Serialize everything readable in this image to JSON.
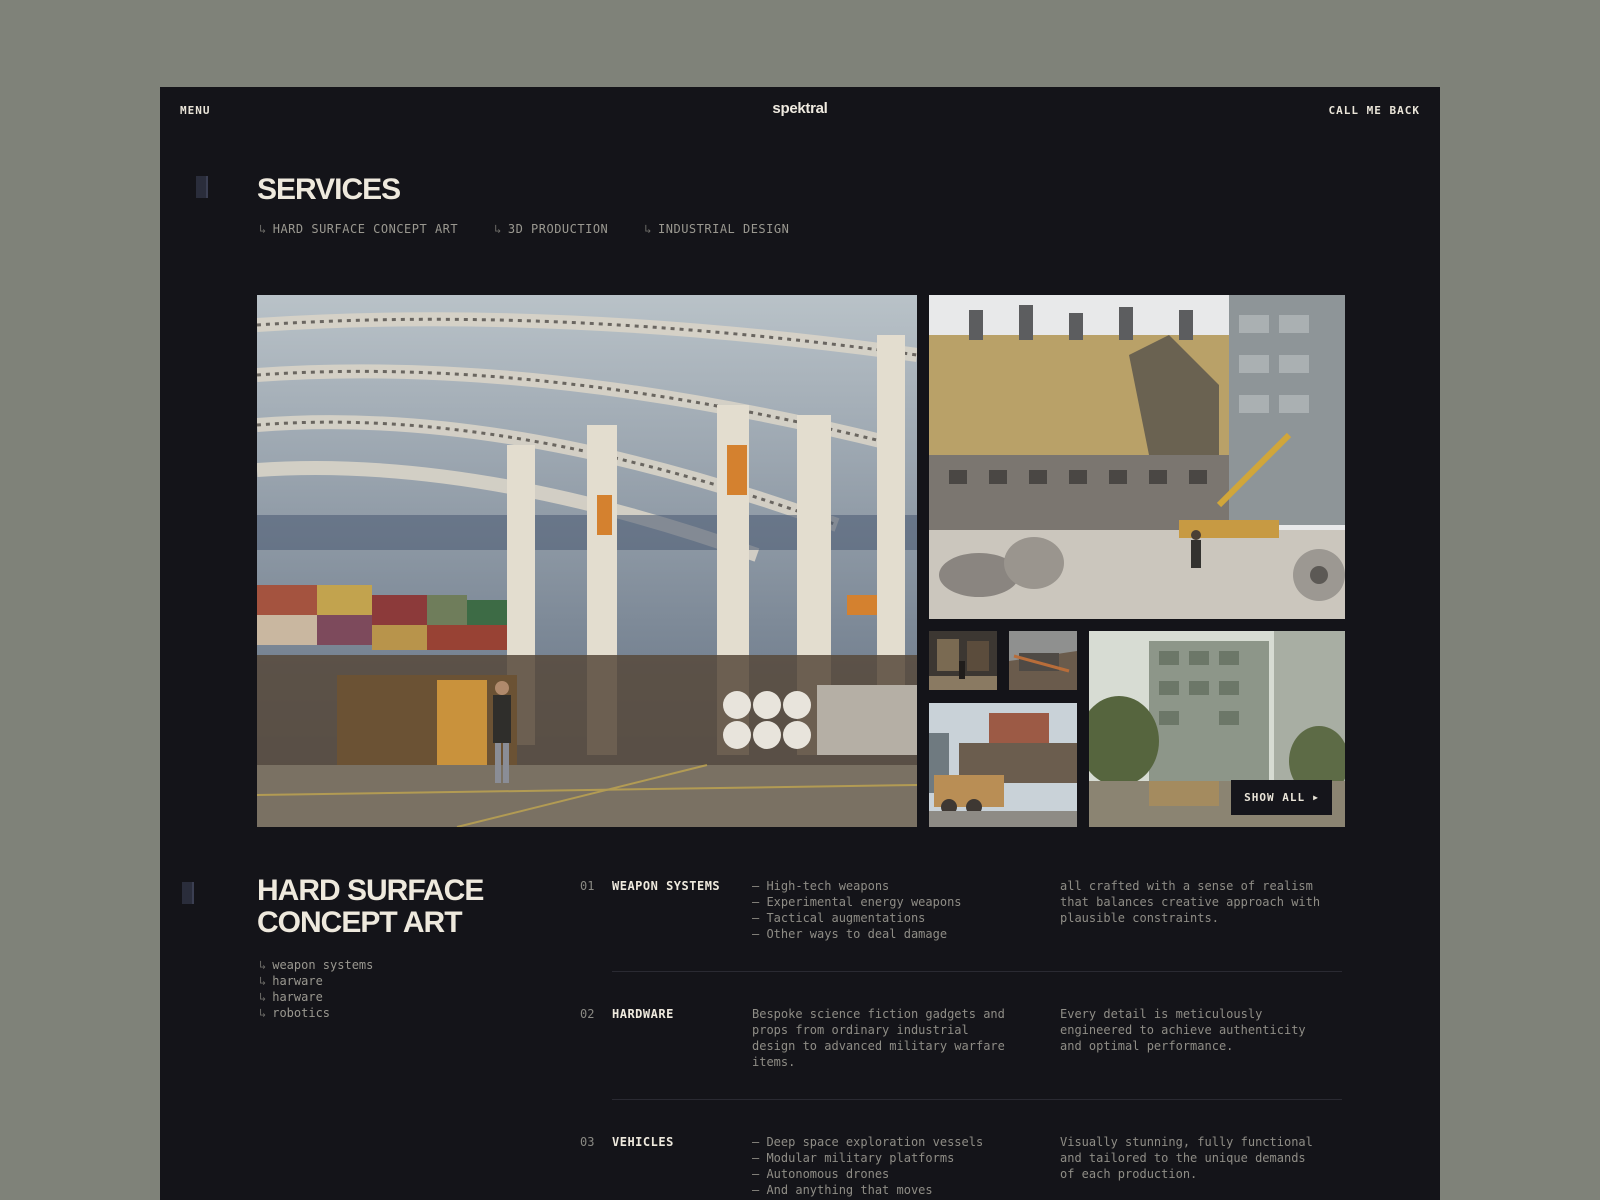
{
  "header": {
    "menu_label": "MENU",
    "logo_text": "spektral",
    "cta_label": "CALL ME BACK"
  },
  "services": {
    "title": "SERVICES",
    "arrow": "↳",
    "tabs": [
      {
        "label": "HARD SURFACE CONCEPT ART"
      },
      {
        "label": "3D PRODUCTION"
      },
      {
        "label": "INDUSTRIAL DESIGN"
      }
    ]
  },
  "gallery": {
    "show_all_label": "SHOW ALL",
    "show_all_icon": "play-triangle-icon"
  },
  "hard_surface": {
    "title_line1": "HARD SURFACE",
    "title_line2": "CONCEPT ART",
    "items": [
      {
        "label": "weapon systems"
      },
      {
        "label": "harware"
      },
      {
        "label": "harware"
      },
      {
        "label": "robotics"
      }
    ]
  },
  "service_rows": [
    {
      "num": "01",
      "name": "WEAPON SYSTEMS",
      "col2": [
        "– High-tech weapons",
        "– Experimental energy weapons",
        "– Tactical augmentations",
        "– Other ways to deal damage"
      ],
      "col3": [
        "all crafted with a sense of realism",
        "that balances creative approach with",
        "plausible constraints."
      ]
    },
    {
      "num": "02",
      "name": "HARDWARE",
      "col2": [
        "Bespoke science fiction gadgets and",
        "props from ordinary industrial",
        "design to advanced military warfare",
        "items."
      ],
      "col3": [
        "Every detail is meticulously",
        "engineered to achieve authenticity",
        "and optimal performance."
      ]
    },
    {
      "num": "03",
      "name": "VEHICLES",
      "col2": [
        "– Deep space exploration vessels",
        "– Modular military platforms",
        "– Autonomous drones",
        "– And anything that moves"
      ],
      "col3": [
        "Visually stunning, fully functional",
        "and tailored to the unique demands",
        "of each production."
      ]
    }
  ],
  "colors": {
    "background": "#7f8279",
    "panel": "#141419",
    "text": "#e9e4d8",
    "muted": "#8f8d86"
  }
}
